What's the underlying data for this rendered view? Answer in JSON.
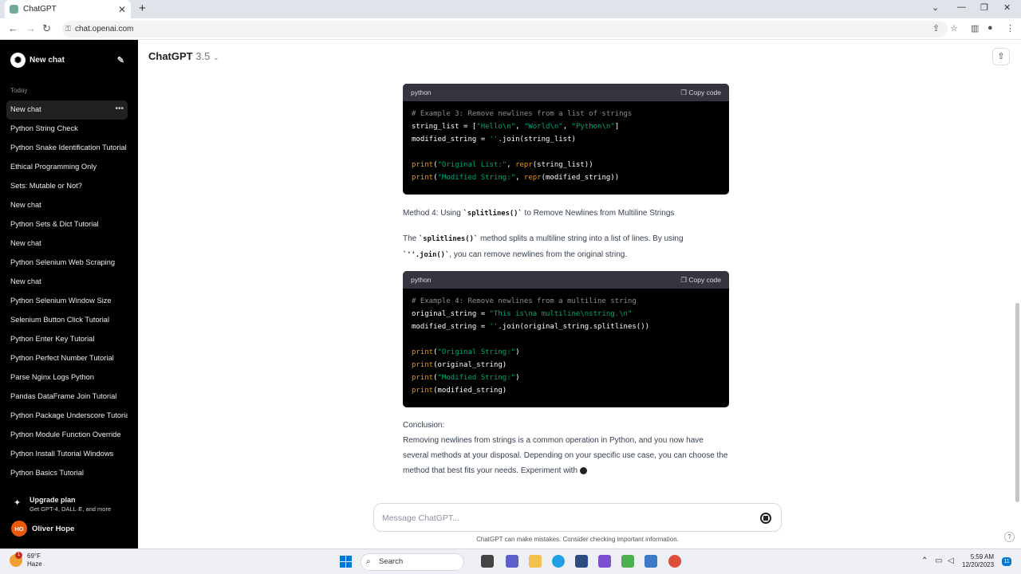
{
  "browser": {
    "tab_title": "ChatGPT",
    "url": "chat.openai.com"
  },
  "sidebar": {
    "new_chat_label": "New chat",
    "section_label": "Today",
    "items": [
      {
        "label": "New chat"
      },
      {
        "label": "Python String Check"
      },
      {
        "label": "Python Snake Identification Tutorial"
      },
      {
        "label": "Ethical Programming Only"
      },
      {
        "label": "Sets: Mutable or Not?"
      },
      {
        "label": "New chat"
      },
      {
        "label": "Python Sets & Dict Tutorial"
      },
      {
        "label": "New chat"
      },
      {
        "label": "Python Selenium Web Scraping"
      },
      {
        "label": "New chat"
      },
      {
        "label": "Python Selenium Window Size"
      },
      {
        "label": "Selenium Button Click Tutorial"
      },
      {
        "label": "Python Enter Key Tutorial"
      },
      {
        "label": "Python Perfect Number Tutorial"
      },
      {
        "label": "Parse Nginx Logs Python"
      },
      {
        "label": "Pandas DataFrame Join Tutorial"
      },
      {
        "label": "Python Package Underscore Tutorial"
      },
      {
        "label": "Python Module Function Override"
      },
      {
        "label": "Python Install Tutorial Windows"
      },
      {
        "label": "Python Basics Tutorial"
      }
    ],
    "upgrade_title": "Upgrade plan",
    "upgrade_subtitle": "Get GPT-4, DALL·E, and more",
    "user_initials": "HO",
    "user_name": "Oliver Hope"
  },
  "header": {
    "model_name": "ChatGPT",
    "model_version": "3.5"
  },
  "code_blocks": [
    {
      "language": "python",
      "copy_label": "Copy code",
      "lines": [
        "# Example 3: Remove newlines from a list of strings",
        "string_list = [\"Hello\\n\", \"World\\n\", \"Python\\n\"]",
        "modified_string = ''.join(string_list)",
        "",
        "print(\"Original List:\", repr(string_list))",
        "print(\"Modified String:\", repr(modified_string))"
      ]
    },
    {
      "language": "python",
      "copy_label": "Copy code",
      "lines": [
        "# Example 4: Remove newlines from a multiline string",
        "original_string = \"This is\\na multiline\\nstring.\\n\"",
        "modified_string = ''.join(original_string.splitlines())",
        "",
        "print(\"Original String:\")",
        "print(original_string)",
        "print(\"Modified String:\")",
        "print(modified_string)"
      ]
    }
  ],
  "prose": {
    "method4_prefix": "Method 4: Using ",
    "method4_code": "`splitlines()`",
    "method4_suffix": " to Remove Newlines from Multiline Strings",
    "para_prefix": "The ",
    "para_code1": "`splitlines()`",
    "para_mid": " method splits a multiline string into a list of lines. By using",
    "para_code2": "`''.join()`",
    "para_suffix": ", you can remove newlines from the original string.",
    "conclusion_heading": "Conclusion:",
    "conclusion_text": "Removing newlines from strings is a common operation in Python, and you now have several methods at your disposal. Depending on your specific use case, you can choose the method that best fits your needs. Experiment with"
  },
  "composer": {
    "placeholder": "Message ChatGPT..."
  },
  "disclaimer": "ChatGPT can make mistakes. Consider checking important information.",
  "taskbar": {
    "weather_temp": "69°F",
    "weather_desc": "Haze",
    "weather_badge": "1",
    "search_label": "Search",
    "time": "5:59 AM",
    "date": "12/20/2023",
    "notification_count": "11"
  }
}
